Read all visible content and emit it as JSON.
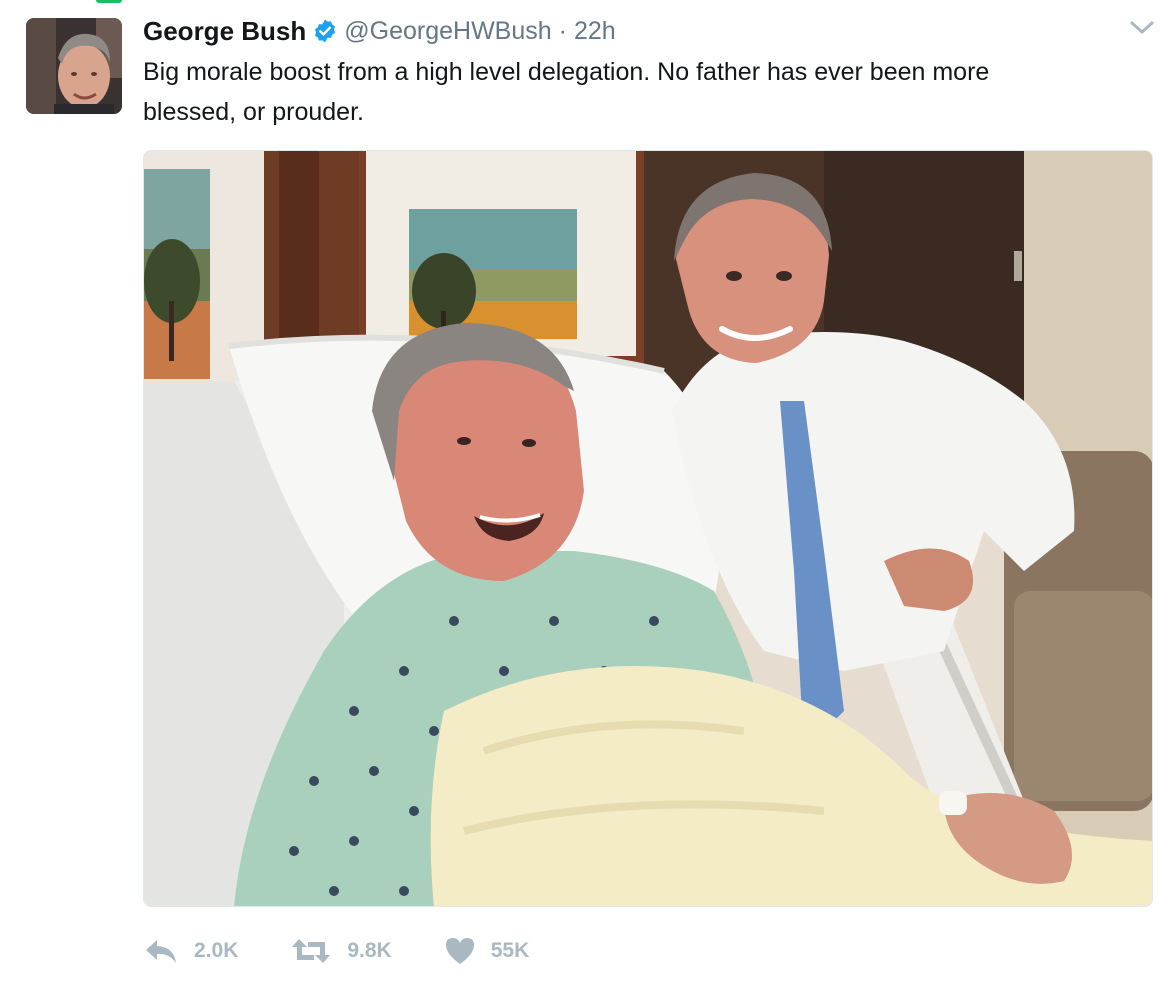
{
  "tweet": {
    "display_name": "George Bush",
    "handle": "@GeorgeHWBush",
    "separator": "·",
    "timestamp": "22h",
    "text_line_1": "Big morale boost from a high level delegation. No father has ever been more",
    "text_line_2": "blessed, or prouder."
  },
  "actions": {
    "reply_count": "2.0K",
    "retweet_count": "9.8K",
    "like_count": "55K"
  },
  "icons": {
    "verified": "verified-badge-icon",
    "menu": "chevron-down-icon",
    "reply": "reply-icon",
    "retweet": "retweet-icon",
    "like": "heart-icon"
  },
  "colors": {
    "text": "#14171a",
    "secondary": "#657786",
    "action_gray": "#aab8c2",
    "verified_blue": "#1da1f2",
    "accent_green": "#17bf63"
  }
}
